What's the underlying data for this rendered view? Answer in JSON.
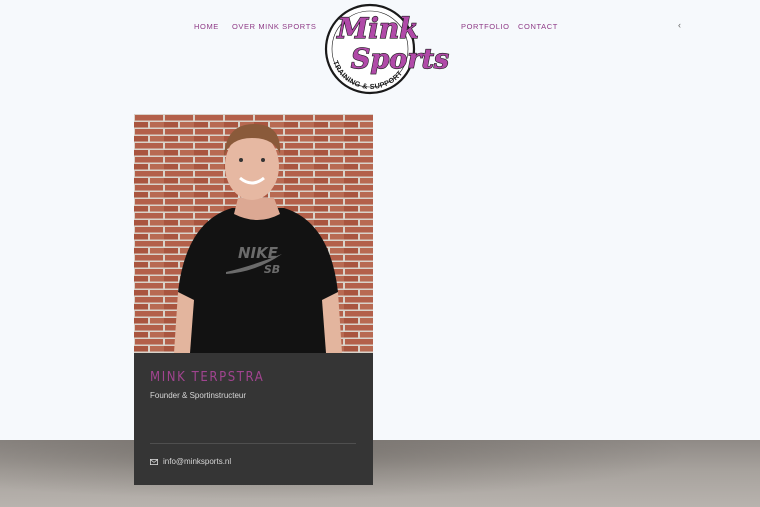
{
  "nav": {
    "left": [
      {
        "label": "HOME"
      },
      {
        "label": "OVER MINK SPORTS"
      }
    ],
    "right": [
      {
        "label": "PORTFOLIO"
      },
      {
        "label": "CONTACT"
      }
    ],
    "toggle_icon": "chevron-left-icon",
    "link_color": "#8e3a86"
  },
  "logo": {
    "line1": "Mink",
    "line2": "Sports",
    "tagline": "TRAINING & SUPPORT",
    "color": "#b04aa8"
  },
  "profile": {
    "name": "MINK TERPSTRA",
    "role": "Founder & Sportinstructeur",
    "email": "info@minksports.nl",
    "email_icon": "envelope-icon",
    "shirt_text_top": "NIKE",
    "shirt_text_bottom": "SB",
    "accent": "#a0448f",
    "card_background": "#353535"
  }
}
